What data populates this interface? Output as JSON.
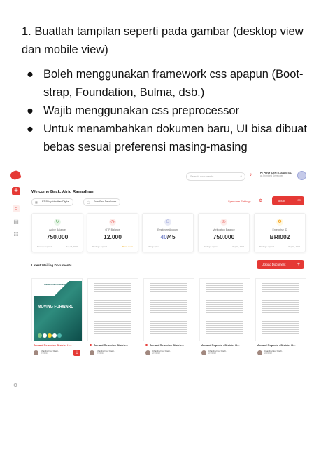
{
  "instructions": {
    "heading": "1. Buatlah tampilan seperti pada gambar (desktop view dan mobile view)",
    "bullets": [
      "Boleh menggunakan framework css apapun (Boot-strap, Foundation, Bulma, dsb.)",
      "Wajib menggunakan css preprocessor",
      "Untuk menambahkan dokumen baru, UI bisa dibuat bebas sesuai preferensi masing-masing"
    ],
    "bullet_glyph": "●"
  },
  "app": {
    "search_placeholder": "Search documents",
    "company_name": "PT PRIVY IDENTITAS DIGITAL",
    "company_role": "as Frontend Developer",
    "welcome": "Welcome Back, Afriq Ramadhan",
    "chips": [
      "PT Privy Identitas Digital",
      "FrontEnd Developer"
    ],
    "speedme_label": "Speedme Settings",
    "topup_label": "Topup",
    "cards": [
      {
        "label": "Active Balance",
        "value": "750.000",
        "foot_left": "Package expired",
        "foot_right": "Aug 29, 2022",
        "icon": "refresh-icon",
        "color": "#43a047"
      },
      {
        "label": "OTP Balance",
        "value": "12.000",
        "foot_left": "Package expired",
        "foot_right": "Reset quota",
        "icon": "timer-icon",
        "color": "#e53935"
      },
      {
        "label": "Employee Account",
        "value_main": "40",
        "value_rest": "/45",
        "foot_left": "Change plan",
        "foot_right": "",
        "icon": "users-icon",
        "color": "#5c6bc0"
      },
      {
        "label": "Verification Balance",
        "value": "750.000",
        "foot_left": "Package expired",
        "foot_right": "Sep 15, 2022",
        "icon": "target-icon",
        "color": "#e53935"
      },
      {
        "label": "Enterprise ID",
        "value": "BRI002",
        "foot_left": "Package expired",
        "foot_right": "Sep 15, 2022",
        "icon": "badge-icon",
        "color": "#f9a825"
      }
    ],
    "latest_label": "Latest Waiting Documents",
    "upload_label": "Upload Document",
    "documents": [
      {
        "title": "Annual Reports - District H...",
        "owner": "Chandra Noor Rach...",
        "date": "2/4/2022",
        "cover_title": "MOVING FORWARD",
        "cover_badge": "Jokowi Hendi Konferensi"
      },
      {
        "title": "Annual Reports - Distric...",
        "owner": "Chandra Noor Rach...",
        "date": "2/4/2022"
      },
      {
        "title": "Annual Reports - Distric...",
        "owner": "Chandra Noor Rach...",
        "date": "2/4/2022"
      },
      {
        "title": "Annual Reports - District H...",
        "owner": "Chandra Noor Rach...",
        "date": "2/4/2022"
      },
      {
        "title": "Annual Reports - District H...",
        "owner": "Chandra Noor Rach...",
        "date": "2/4/2022"
      }
    ],
    "accent": "#e53935"
  }
}
